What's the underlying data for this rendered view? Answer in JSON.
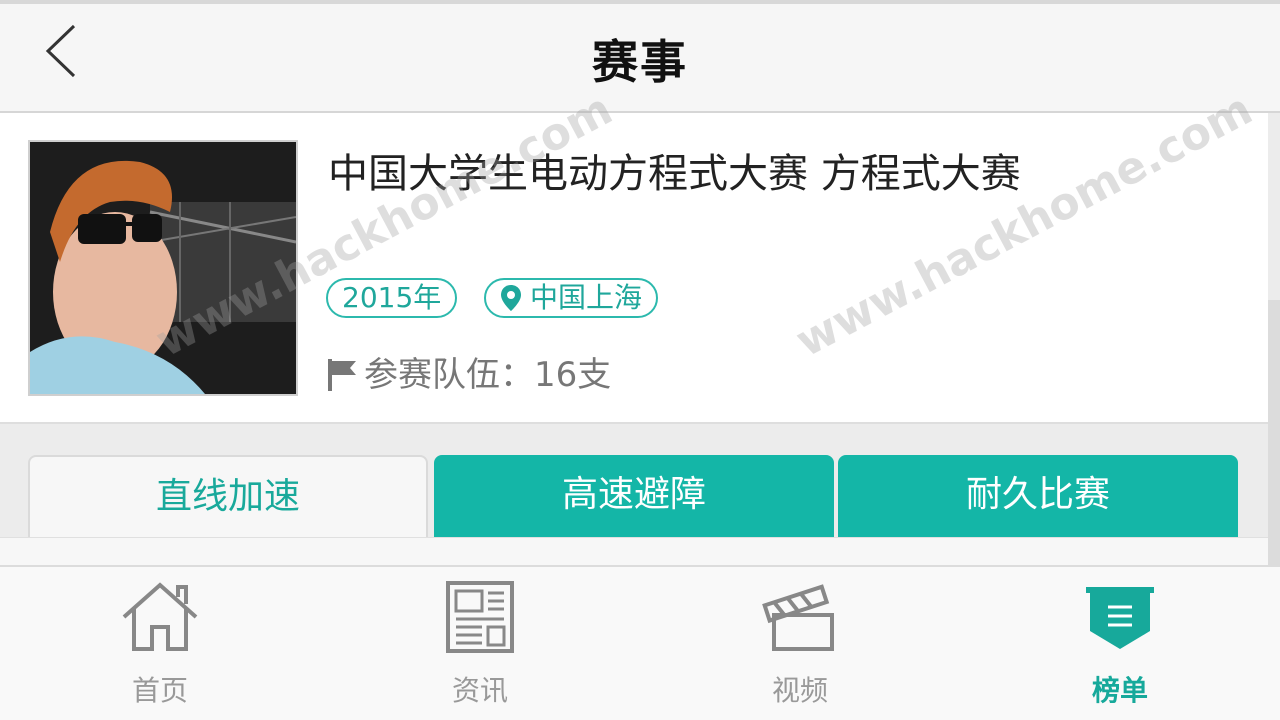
{
  "header": {
    "title": "赛事",
    "back_icon": "chevron-left-icon"
  },
  "event": {
    "title": "中国大学生电动方程式大赛 方程式大赛",
    "year_tag": "2015年",
    "location_tag": "中国上海",
    "location_icon": "map-pin-icon",
    "teams_text": "参赛队伍：16支",
    "teams_icon": "flag-icon"
  },
  "tabs": [
    {
      "label": "直线加速",
      "active": true
    },
    {
      "label": "高速避障",
      "active": false
    },
    {
      "label": "耐久比赛",
      "active": false
    }
  ],
  "watermark": "www.hackhome.com",
  "bottom_nav": {
    "items": [
      {
        "label": "首页",
        "icon": "home-icon",
        "active": false
      },
      {
        "label": "资讯",
        "icon": "news-icon",
        "active": false
      },
      {
        "label": "视频",
        "icon": "clapperboard-icon",
        "active": false
      },
      {
        "label": "榜单",
        "icon": "ranking-icon",
        "active": true
      }
    ]
  },
  "colors": {
    "accent": "#14b6a7",
    "accent_text": "#19a99b",
    "header_bg": "#f6f6f6",
    "inactive_nav": "#999999"
  }
}
